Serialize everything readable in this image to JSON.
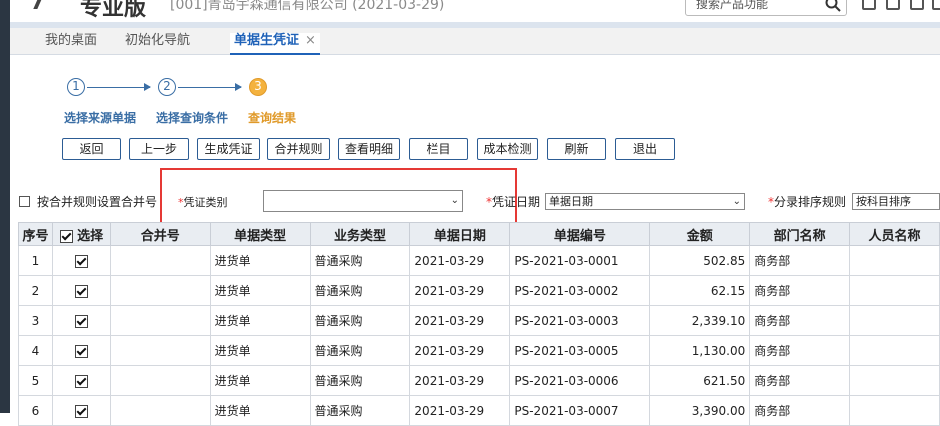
{
  "header": {
    "logo_fragment": "7",
    "edition": "专业版",
    "company": "[001]青岛宇森通信有限公司   (2021-03-29)",
    "search_placeholder": "搜索产品功能"
  },
  "tabs": [
    {
      "label": "我的桌面"
    },
    {
      "label": "初始化导航"
    },
    {
      "label": "单据生凭证",
      "close": "×"
    }
  ],
  "steps": [
    {
      "num": "1",
      "label": "选择来源单据",
      "state": "done"
    },
    {
      "num": "2",
      "label": "选择查询条件",
      "state": "done"
    },
    {
      "num": "3",
      "label": "查询结果",
      "state": "current"
    }
  ],
  "toolbar": [
    "返回",
    "上一步",
    "生成凭证",
    "合并规则",
    "查看明细",
    "栏目",
    "成本检测",
    "刷新",
    "退出"
  ],
  "options": {
    "merge_rule_label": "按合并规则设置合并号",
    "voucher_type_label": "凭证类别",
    "voucher_type_value": "",
    "voucher_date_label": "凭证日期",
    "voucher_date_value": "单据日期",
    "sort_rule_label": "分录排序规则",
    "sort_rule_value": "按科目排序",
    "required_mark": "*"
  },
  "table": {
    "headers": [
      "序号",
      "选择",
      "合并号",
      "单据类型",
      "业务类型",
      "单据日期",
      "单据编号",
      "金额",
      "部门名称",
      "人员名称"
    ],
    "rows": [
      {
        "no": "1",
        "merge": "",
        "doc_type": "进货单",
        "biz_type": "普通采购",
        "date": "2021-03-29",
        "doc_no": "PS-2021-03-0001",
        "amount": "502.85",
        "dept": "商务部",
        "person": ""
      },
      {
        "no": "2",
        "merge": "",
        "doc_type": "进货单",
        "biz_type": "普通采购",
        "date": "2021-03-29",
        "doc_no": "PS-2021-03-0002",
        "amount": "62.15",
        "dept": "商务部",
        "person": ""
      },
      {
        "no": "3",
        "merge": "",
        "doc_type": "进货单",
        "biz_type": "普通采购",
        "date": "2021-03-29",
        "doc_no": "PS-2021-03-0003",
        "amount": "2,339.10",
        "dept": "商务部",
        "person": ""
      },
      {
        "no": "4",
        "merge": "",
        "doc_type": "进货单",
        "biz_type": "普通采购",
        "date": "2021-03-29",
        "doc_no": "PS-2021-03-0005",
        "amount": "1,130.00",
        "dept": "商务部",
        "person": ""
      },
      {
        "no": "5",
        "merge": "",
        "doc_type": "进货单",
        "biz_type": "普通采购",
        "date": "2021-03-29",
        "doc_no": "PS-2021-03-0006",
        "amount": "621.50",
        "dept": "商务部",
        "person": ""
      },
      {
        "no": "6",
        "merge": "",
        "doc_type": "进货单",
        "biz_type": "普通采购",
        "date": "2021-03-29",
        "doc_no": "PS-2021-03-0007",
        "amount": "3,390.00",
        "dept": "商务部",
        "person": ""
      }
    ]
  },
  "colors": {
    "accent": "#1f62b8",
    "current_step": "#f4b23e",
    "highlight_box": "#e53935"
  }
}
